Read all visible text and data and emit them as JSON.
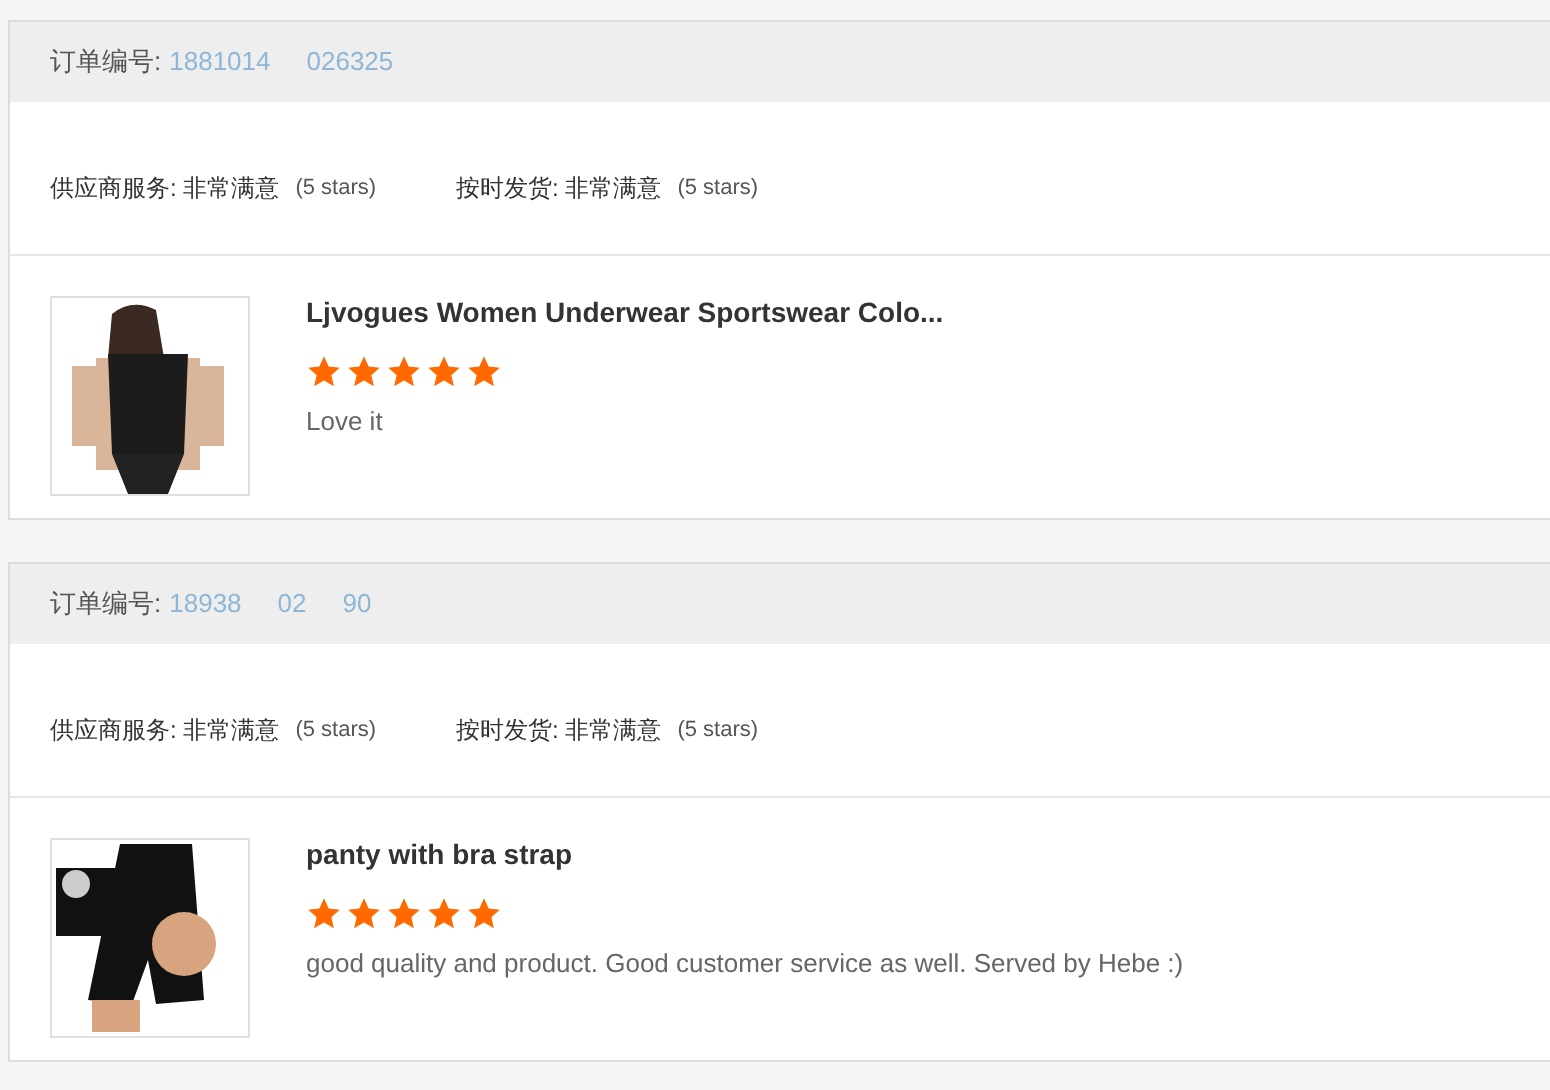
{
  "orders": [
    {
      "order_label": "订单编号:",
      "order_number_parts": [
        "1881014",
        "026325"
      ],
      "ratings": [
        {
          "label": "供应商服务:",
          "value": "非常满意",
          "stars_text": "(5 stars)"
        },
        {
          "label": "按时发货:",
          "value": "非常满意",
          "stars_text": "(5 stars)"
        }
      ],
      "product": {
        "kind": "top",
        "title": "Ljvogues Women Underwear Sportswear Colo...",
        "stars": 5,
        "comment": "Love it"
      }
    },
    {
      "order_label": "订单编号:",
      "order_number_parts": [
        "18938",
        "02",
        "90"
      ],
      "ratings": [
        {
          "label": "供应商服务:",
          "value": "非常满意",
          "stars_text": "(5 stars)"
        },
        {
          "label": "按时发货:",
          "value": "非常满意",
          "stars_text": "(5 stars)"
        }
      ],
      "product": {
        "kind": "shorts",
        "title": "panty with bra strap",
        "stars": 5,
        "comment": "good quality and product. Good customer service as well. Served by Hebe :)"
      }
    }
  ]
}
